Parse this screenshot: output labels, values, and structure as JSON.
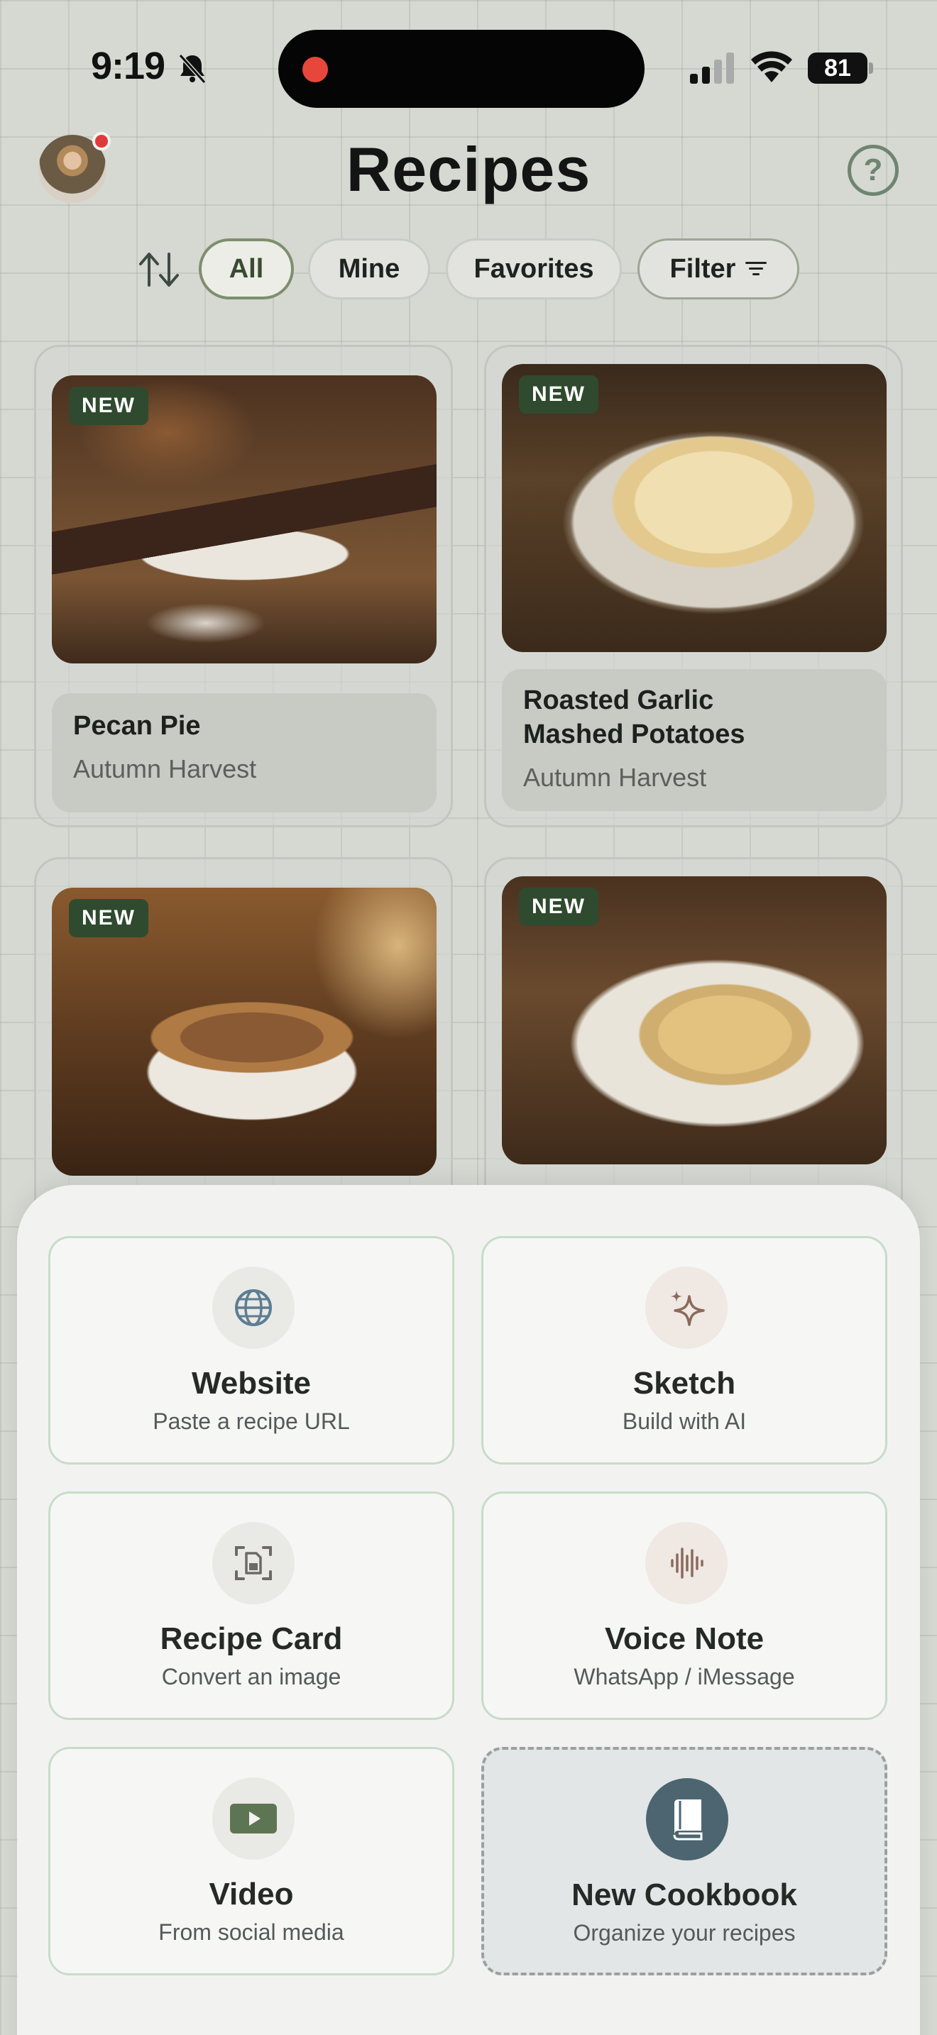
{
  "status_bar": {
    "time": "9:19",
    "battery": "81"
  },
  "header": {
    "title": "Recipes",
    "help": "?"
  },
  "filters": {
    "chips": [
      {
        "label": "All",
        "active": true
      },
      {
        "label": "Mine",
        "active": false
      },
      {
        "label": "Favorites",
        "active": false
      },
      {
        "label": "Filter",
        "active": false
      }
    ]
  },
  "recipes": [
    {
      "badge": "NEW",
      "title": "Pecan Pie",
      "cookbook": "Autumn Harvest"
    },
    {
      "badge": "NEW",
      "title_line1": "Roasted Garlic",
      "title_line2": "Mashed Potatoes",
      "cookbook": "Autumn Harvest"
    },
    {
      "badge": "NEW"
    },
    {
      "badge": "NEW"
    }
  ],
  "add_sheet": {
    "actions": [
      {
        "icon": "globe-icon",
        "title": "Website",
        "subtitle": "Paste a recipe URL"
      },
      {
        "icon": "sparkle-icon",
        "title": "Sketch",
        "subtitle": "Build with AI"
      },
      {
        "icon": "scan-document-icon",
        "title": "Recipe Card",
        "subtitle": "Convert an image"
      },
      {
        "icon": "waveform-icon",
        "title": "Voice Note",
        "subtitle": "WhatsApp / iMessage"
      },
      {
        "icon": "play-icon",
        "title": "Video",
        "subtitle": "From social media"
      },
      {
        "icon": "book-icon",
        "title": "New Cookbook",
        "subtitle": "Organize your recipes"
      }
    ]
  },
  "colors": {
    "accent": "#7d8f6e",
    "badge": "#2f4a2f",
    "cookbook_icon_bg": "#4c6570"
  }
}
